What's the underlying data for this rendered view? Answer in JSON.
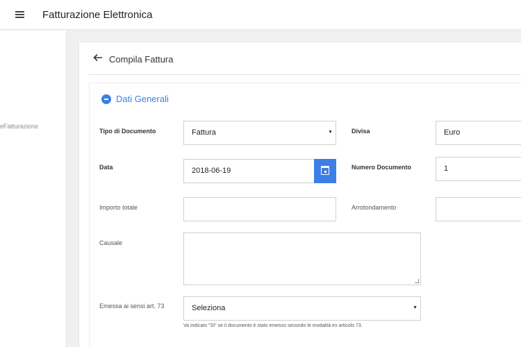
{
  "header": {
    "title": "Fatturazione Elettronica",
    "menu_icon": "hamburger-menu-icon"
  },
  "sidebar": {
    "items": [
      {
        "label": "eFatturazione"
      }
    ]
  },
  "page": {
    "title": "Compila Fattura",
    "back_icon": "arrow-left-icon"
  },
  "section": {
    "title": "Dati Generali",
    "icon": "collapse-circle-icon",
    "accent_color": "#3d7ee6"
  },
  "form": {
    "tipo_documento": {
      "label": "Tipo di Documento",
      "value": "Fattura"
    },
    "divisa": {
      "label": "Divisa",
      "value": "Euro"
    },
    "data": {
      "label": "Data",
      "value": "2018-06-19",
      "icon": "calendar-icon"
    },
    "numero_documento": {
      "label": "Numero Documento",
      "value": "1"
    },
    "importo_totale": {
      "label": "Importo totale",
      "value": ""
    },
    "arrotondamento": {
      "label": "Arrotondamento",
      "value": ""
    },
    "causale": {
      "label": "Causale",
      "value": ""
    },
    "emessa": {
      "label": "Emessa ai sensi art. 73",
      "value": "Seleziona",
      "hint": "Va indicato \"SI\" se il documento è stato emesso secondo le modalità ex articolo 73."
    }
  }
}
